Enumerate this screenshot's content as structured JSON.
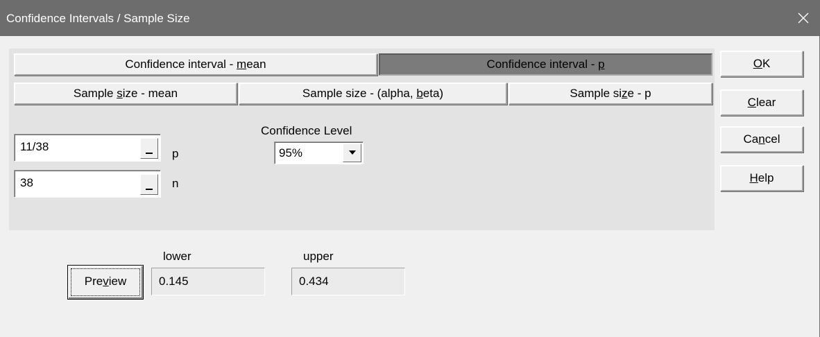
{
  "window": {
    "title": "Confidence Intervals / Sample Size"
  },
  "tabs": {
    "ci_mean": {
      "pre": "Confidence interval - ",
      "key": "m",
      "post": "ean"
    },
    "ci_p": {
      "pre": "Confidence interval - ",
      "key": "p",
      "post": "",
      "active": true
    },
    "ss_mean": {
      "pre": "Sample ",
      "key": "s",
      "post": "ize - mean"
    },
    "ss_alpha_beta": {
      "pre": "Sample size - (alpha, ",
      "key": "b",
      "post": "eta)"
    },
    "ss_p": {
      "pre": "Sample si",
      "key": "z",
      "post": "e - p"
    }
  },
  "inputs": {
    "p": {
      "value": "11/38",
      "label": "p"
    },
    "n": {
      "value": "38",
      "label": "n"
    }
  },
  "confidence": {
    "label": "Confidence Level",
    "selected": "95%"
  },
  "buttons": {
    "ok": {
      "pre": "",
      "key": "O",
      "post": "K"
    },
    "clear": {
      "pre": "",
      "key": "C",
      "post": "lear"
    },
    "cancel": {
      "pre": "Ca",
      "key": "n",
      "post": "cel"
    },
    "help": {
      "pre": "",
      "key": "H",
      "post": "elp"
    },
    "preview": {
      "pre": "Pre",
      "key": "v",
      "post": "iew"
    }
  },
  "results": {
    "lower": {
      "label": "lower",
      "value": "0.145"
    },
    "upper": {
      "label": "upper",
      "value": "0.434"
    }
  },
  "colors": {
    "titlebar": "#6d6d6d",
    "active_tab": "#7b7b7b",
    "dialog_bg": "#f0f0f0",
    "panel_bg": "#e3e3e3"
  },
  "icons": {
    "close": "close-icon",
    "dropdown": "chevron-down-icon"
  }
}
